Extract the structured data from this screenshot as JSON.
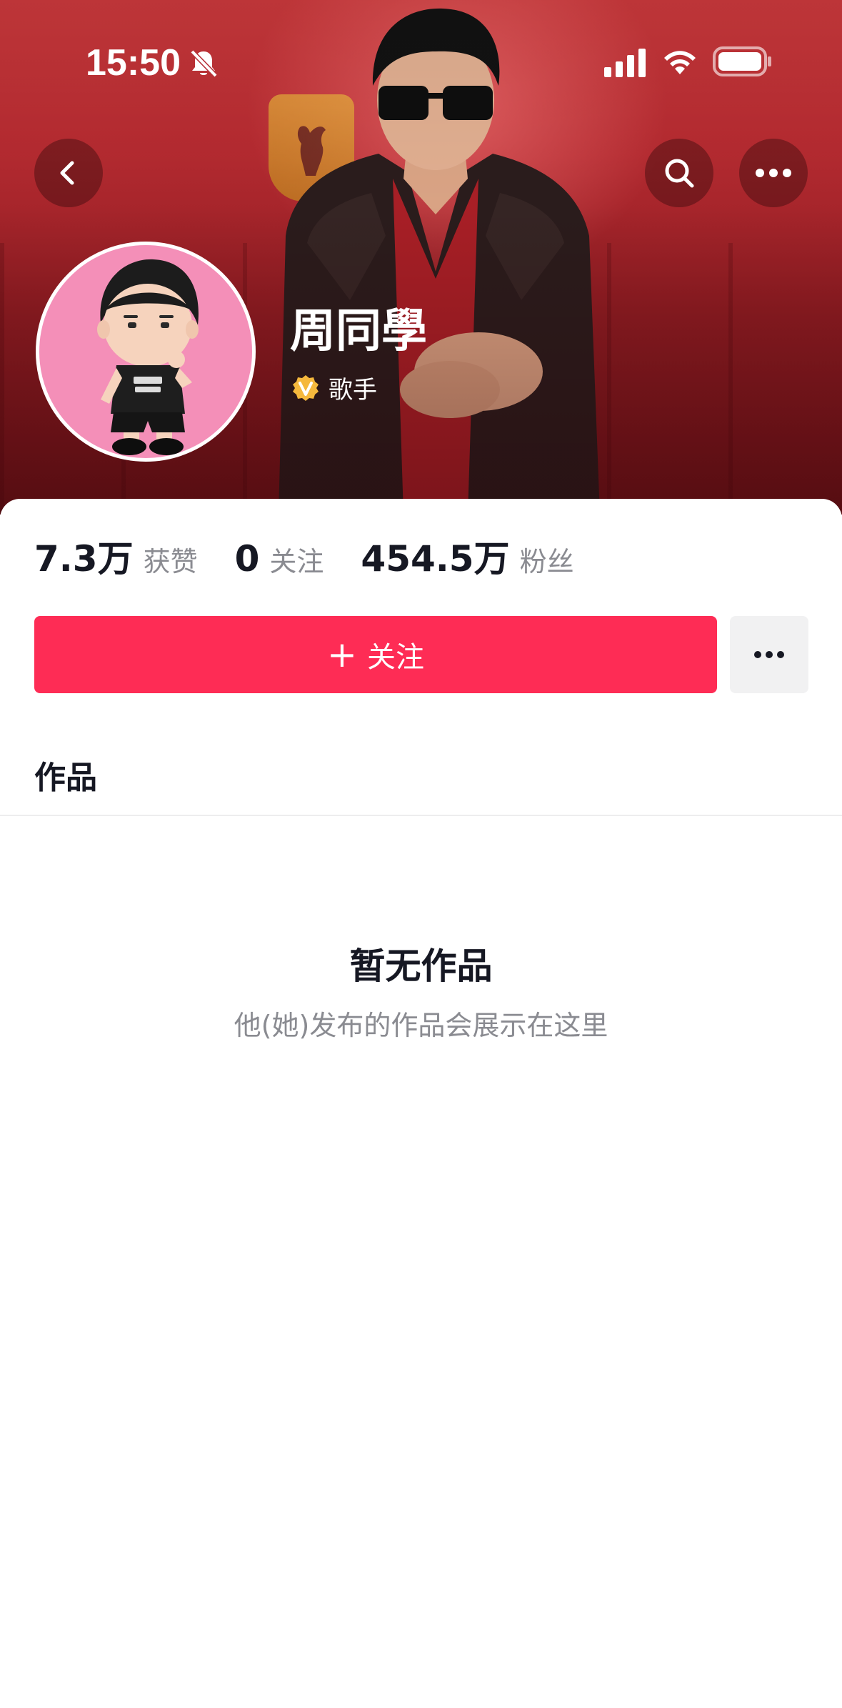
{
  "status_bar": {
    "time": "15:50",
    "icons": [
      "bell-muted-icon",
      "cellular-signal-icon",
      "wifi-icon",
      "battery-icon"
    ]
  },
  "nav": {
    "back_icon": "chevron-left-icon",
    "search_icon": "search-icon",
    "more_icon": "more-horizontal-icon"
  },
  "profile": {
    "name": "周同學",
    "verified_label": "歌手",
    "verified_badge_color": "#f5b83d"
  },
  "stats": [
    {
      "value": "7.3万",
      "label": "获赞"
    },
    {
      "value": "0",
      "label": "关注"
    },
    {
      "value": "454.5万",
      "label": "粉丝"
    }
  ],
  "actions": {
    "follow_plus": "+",
    "follow_label": "关注",
    "follow_color": "#fe2c55",
    "more_icon": "more-horizontal-icon"
  },
  "tabs": {
    "works_label": "作品"
  },
  "empty_state": {
    "title": "暂无作品",
    "subtitle": "他(她)发布的作品会展示在这里"
  }
}
